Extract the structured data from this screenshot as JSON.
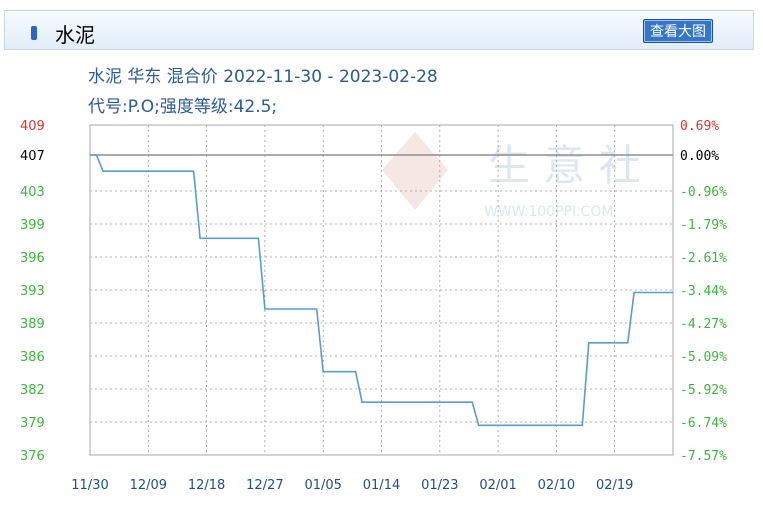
{
  "header": {
    "title": "水泥",
    "view_large_label": "查看大图"
  },
  "chart_data": {
    "type": "line",
    "title": "水泥 华东 混合价 2022-11-30 - 2023-02-28",
    "subtitle": "代号:P.O;强度等级:42.5;",
    "watermark": {
      "text": "生 意 社",
      "url": "WWW.100PPI.COM"
    },
    "x_tick_labels": [
      "11/30",
      "12/09",
      "12/18",
      "12/27",
      "01/05",
      "01/14",
      "01/23",
      "02/01",
      "02/10",
      "02/19"
    ],
    "y_left_ticks": [
      "409",
      "407",
      "403",
      "399",
      "396",
      "393",
      "389",
      "386",
      "382",
      "379",
      "376"
    ],
    "y_right_ticks": [
      "0.69%",
      "0.00%",
      "-0.96%",
      "-1.79%",
      "-2.61%",
      "-3.44%",
      "-4.27%",
      "-5.09%",
      "-5.92%",
      "-6.74%",
      "-7.57%"
    ],
    "ylim": [
      376,
      409
    ],
    "baseline": 407,
    "colors": {
      "line": "#5b9bd5",
      "positive": "#e0322f",
      "negative": "#3db63d",
      "neutral": "#000000",
      "axis_label": "#1f4f8b",
      "grid": "#9a9a9a"
    },
    "series": [
      {
        "x": [
          "2022-11-30",
          "2022-12-01",
          "2022-12-02",
          "2022-12-16",
          "2022-12-17",
          "2022-12-26",
          "2022-12-27",
          "2023-01-04",
          "2023-01-05",
          "2023-01-10",
          "2023-01-11",
          "2023-01-28",
          "2023-01-29",
          "2023-02-14",
          "2023-02-15",
          "2023-02-21",
          "2023-02-22",
          "2023-02-28"
        ],
        "y": [
          407,
          407,
          405.2,
          405.2,
          397.7,
          397.7,
          390.7,
          390.7,
          384.1,
          384.1,
          380.8,
          380.8,
          378.7,
          378.7,
          387.2,
          387.2,
          392.7,
          392.7
        ]
      }
    ]
  }
}
